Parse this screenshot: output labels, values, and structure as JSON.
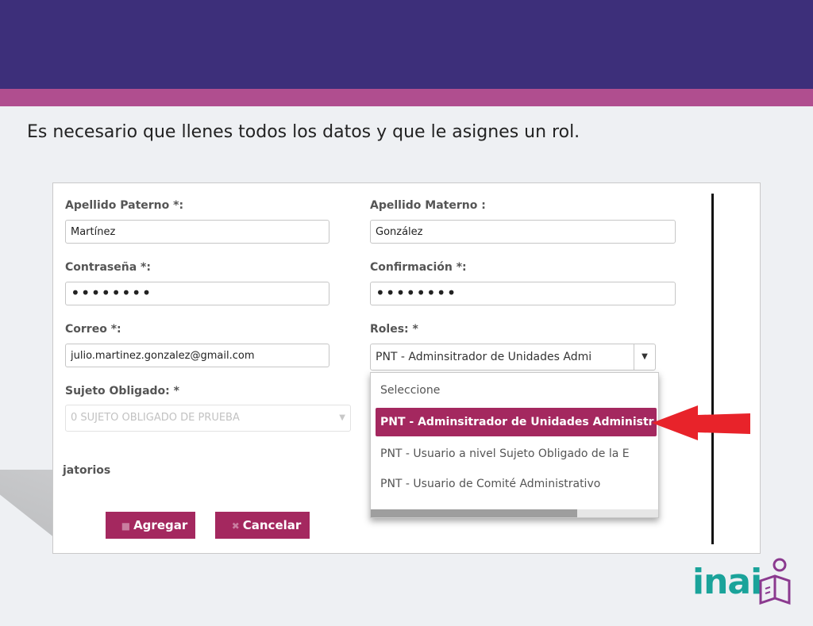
{
  "caption": "Es necesario que llenes todos los datos y que le asignes un rol.",
  "form": {
    "apellido_paterno_label": "Apellido Paterno *:",
    "apellido_paterno_value": "Martínez",
    "apellido_materno_label": "Apellido Materno :",
    "apellido_materno_value": "González",
    "contrasena_label": "Contraseña *:",
    "contrasena_value": "••••••••",
    "confirmacion_label": "Confirmación *:",
    "confirmacion_value": "••••••••",
    "correo_label": "Correo *:",
    "correo_value": "julio.martinez.gonzalez@gmail.com",
    "roles_label": "Roles: *",
    "roles_selected": "PNT - Adminsitrador de Unidades Admi",
    "sujeto_label": "Sujeto Obligado: *",
    "sujeto_value": "0 SUJETO OBLIGADO DE PRUEBA",
    "partial_text": "jatorios"
  },
  "dropdown": {
    "options": [
      "Seleccione",
      "PNT - Adminsitrador de Unidades Administr",
      "PNT - Usuario a nivel Sujeto Obligado de la E",
      "PNT - Usuario de Comité Administrativo"
    ],
    "selected_index": 1
  },
  "buttons": {
    "agregar": "Agregar",
    "cancelar": "Cancelar"
  },
  "logo": {
    "text": "inai"
  },
  "colors": {
    "header": "#3d2f7a",
    "accent_band": "#b04e8f",
    "button": "#a4285f",
    "arrow": "#e8232a",
    "logo": "#1aa39a",
    "logo_icon": "#8b3a8f"
  },
  "icons": [
    "save-icon",
    "close-icon",
    "caret-down-icon",
    "red-arrow-icon",
    "reader-book-icon"
  ]
}
